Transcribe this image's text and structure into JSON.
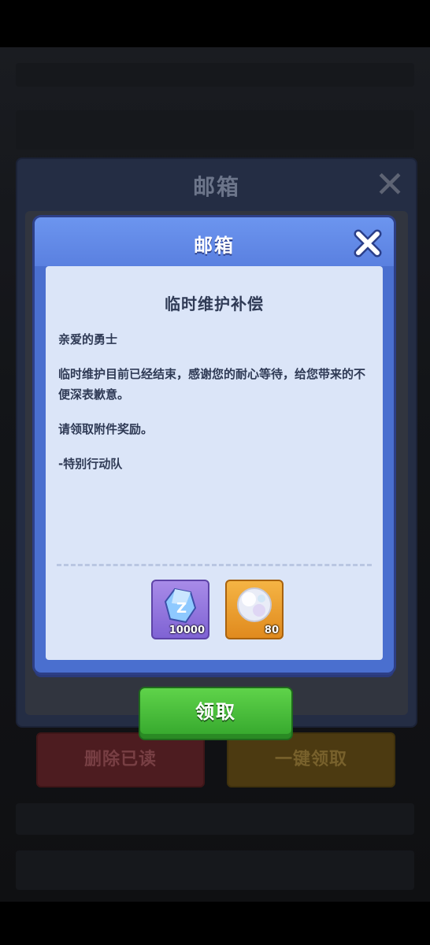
{
  "background": {
    "window_title": "邮箱",
    "delete_read_label": "删除已读",
    "claim_all_label": "一键领取"
  },
  "dialog": {
    "title": "邮箱",
    "mail": {
      "subject": "临时维护补偿",
      "greeting": "亲爱的勇士",
      "paragraph1": "临时维护目前已经结束，感谢您的耐心等待，给您带来的不便深表歉意。",
      "paragraph2": "请领取附件奖励。",
      "signature": "-特别行动队"
    },
    "rewards": [
      {
        "icon": "purple-crystal-icon",
        "quantity": "10000"
      },
      {
        "icon": "pearl-orb-icon",
        "quantity": "80"
      }
    ],
    "claim_label": "领取"
  },
  "colors": {
    "dialog_blue": "#4a6fcf",
    "paper": "#dbe5f8",
    "claim_green": "#3cb234"
  }
}
